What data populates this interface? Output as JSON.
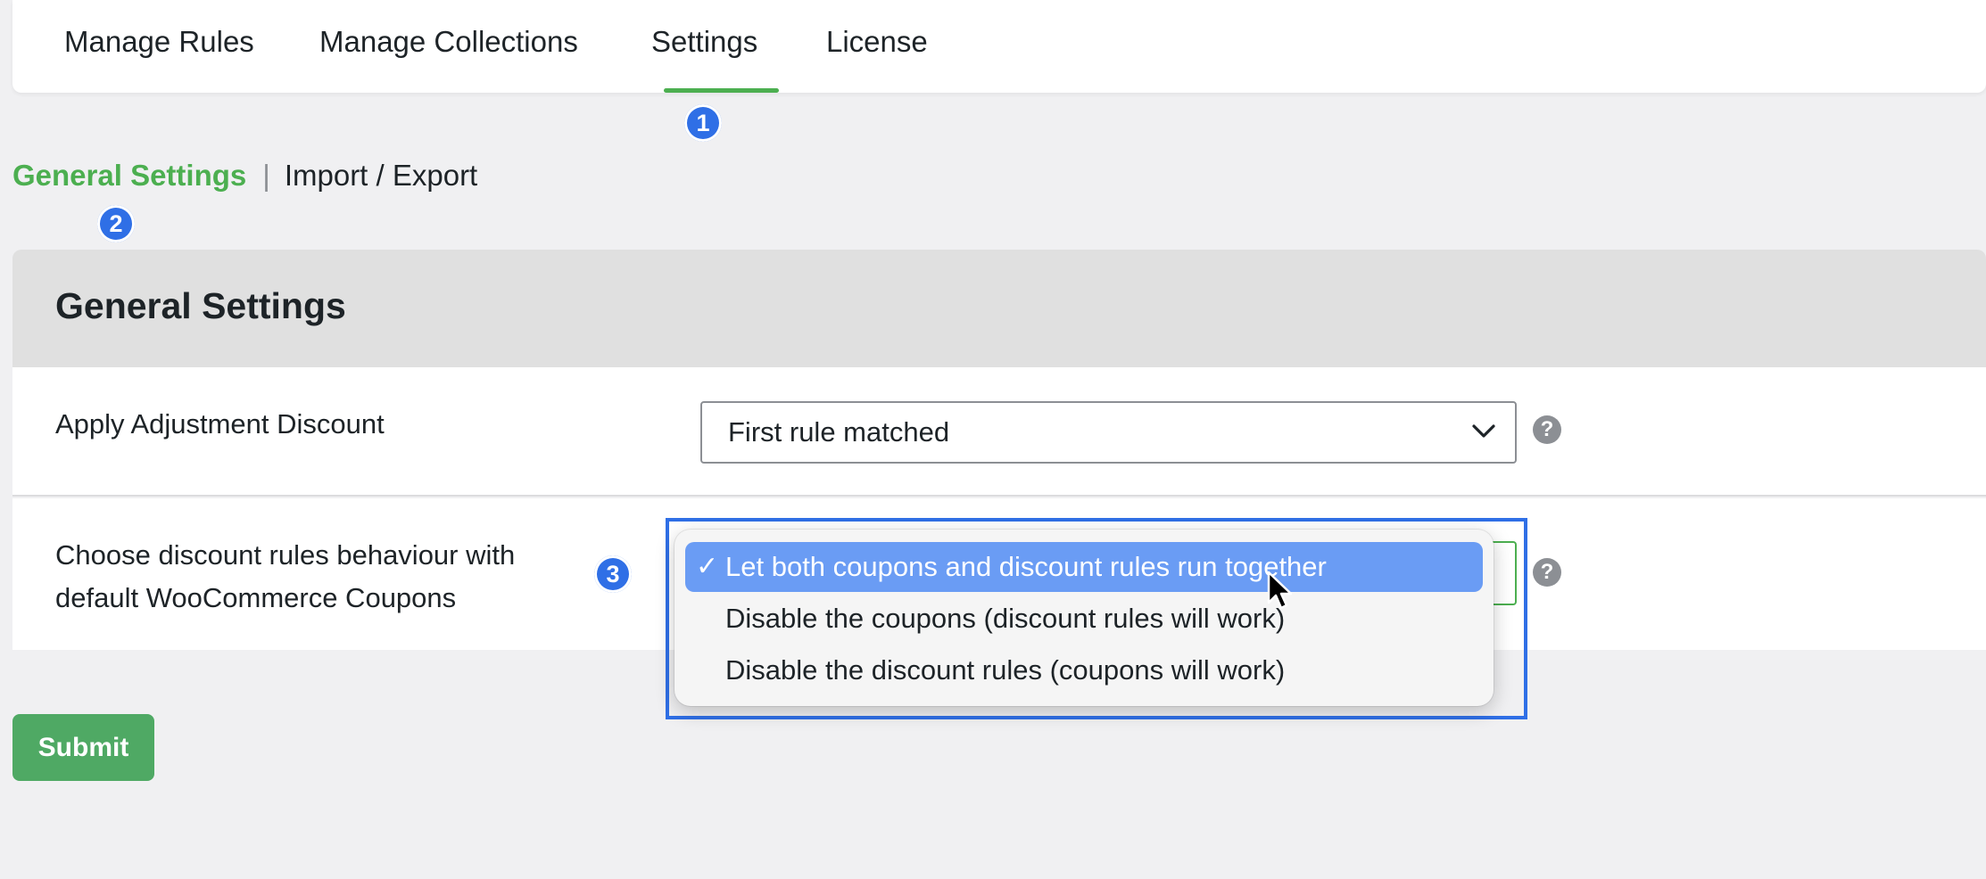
{
  "colors": {
    "accent_green": "#4caf50",
    "selection_blue": "#6a9cf4",
    "badge_blue": "#2f6fe6",
    "submit_green": "#4fa964"
  },
  "tabs": [
    {
      "label": "Manage Rules",
      "active": false
    },
    {
      "label": "Manage Collections",
      "active": false
    },
    {
      "label": "Settings",
      "active": true
    },
    {
      "label": "License",
      "active": false
    }
  ],
  "badges": [
    "1",
    "2",
    "3"
  ],
  "subnav": {
    "active_label": "General Settings",
    "separator": "|",
    "other_label": "Import / Export"
  },
  "card": {
    "title": "General Settings",
    "rows": [
      {
        "label": "Apply Adjustment Discount",
        "select_value": "First rule matched",
        "help": "?"
      },
      {
        "label_line1": "Choose discount rules behaviour with",
        "label_line2": "default WooCommerce Coupons",
        "help": "?",
        "options": [
          {
            "label": "Let both coupons and discount rules run together",
            "selected": true
          },
          {
            "label": "Disable the coupons (discount rules will work)",
            "selected": false
          },
          {
            "label": "Disable the discount rules (coupons will work)",
            "selected": false
          }
        ],
        "check_glyph": "✓"
      }
    ]
  },
  "submit_label": "Submit"
}
